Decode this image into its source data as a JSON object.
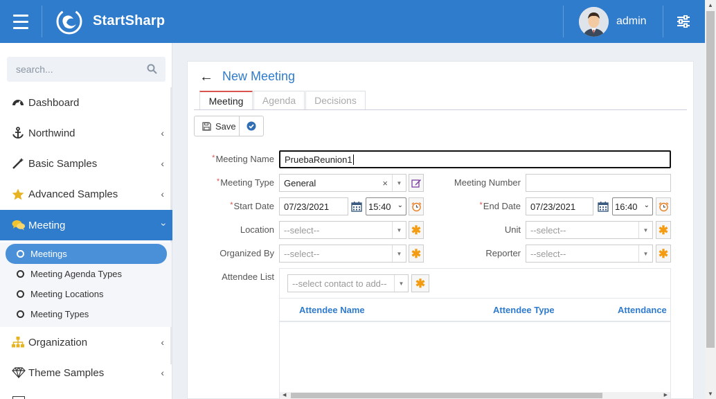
{
  "header": {
    "brand": "StartSharp",
    "username": "admin"
  },
  "sidebar": {
    "search_placeholder": "search...",
    "items": [
      {
        "label": "Dashboard",
        "icon": "dashboard-icon"
      },
      {
        "label": "Northwind",
        "icon": "anchor-icon"
      },
      {
        "label": "Basic Samples",
        "icon": "magic-wand-icon"
      },
      {
        "label": "Advanced Samples",
        "icon": "star-icon"
      },
      {
        "label": "Meeting",
        "icon": "chat-bubbles-icon"
      },
      {
        "label": "Organization",
        "icon": "sitemap-icon"
      },
      {
        "label": "Theme Samples",
        "icon": "diamond-icon"
      }
    ],
    "meeting_sub": [
      "Meetings",
      "Meeting Agenda Types",
      "Meeting Locations",
      "Meeting Types"
    ]
  },
  "page": {
    "title": "New Meeting",
    "tabs": [
      "Meeting",
      "Agenda",
      "Decisions"
    ],
    "toolbar": {
      "save_label": "Save"
    }
  },
  "form": {
    "meeting_name": {
      "label": "Meeting Name",
      "value": "PruebaReunion1"
    },
    "meeting_type": {
      "label": "Meeting Type",
      "value": "General"
    },
    "meeting_number": {
      "label": "Meeting Number",
      "value": ""
    },
    "start_date": {
      "label": "Start Date",
      "date": "07/23/2021",
      "time": "15:40"
    },
    "end_date": {
      "label": "End Date",
      "date": "07/23/2021",
      "time": "16:40"
    },
    "location": {
      "label": "Location",
      "placeholder": "--select--"
    },
    "unit": {
      "label": "Unit",
      "placeholder": "--select--"
    },
    "organized_by": {
      "label": "Organized By",
      "placeholder": "--select--"
    },
    "reporter": {
      "label": "Reporter",
      "placeholder": "--select--"
    },
    "attendee_list": {
      "label": "Attendee List",
      "placeholder": "--select contact to add--"
    }
  },
  "attendee_grid": {
    "columns": [
      "Attendee Name",
      "Attendee Type",
      "Attendance"
    ]
  },
  "colors": {
    "primary": "#2f7bcc",
    "required": "#d9534f",
    "accent_star": "#f39c12"
  }
}
